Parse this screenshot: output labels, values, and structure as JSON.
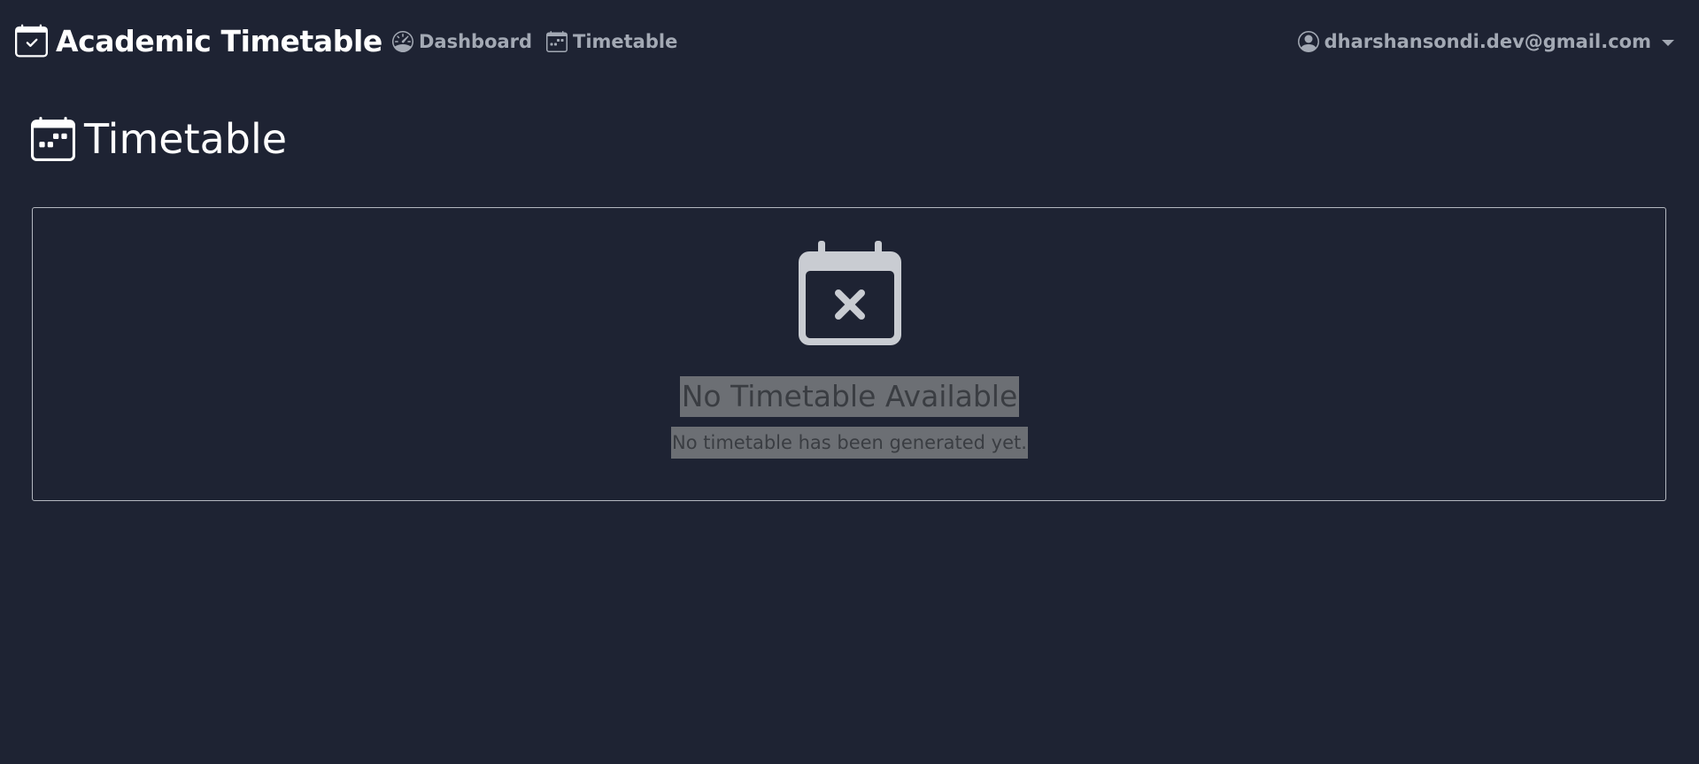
{
  "navbar": {
    "brand": "Academic Timetable",
    "links": [
      {
        "label": "Dashboard",
        "icon": "speedometer-icon"
      },
      {
        "label": "Timetable",
        "icon": "calendar-icon"
      }
    ],
    "user": {
      "email": "dharshansondi.dev@gmail.com",
      "icon": "user-circle-icon"
    }
  },
  "page": {
    "title": "Timetable",
    "title_icon": "calendar-week-icon"
  },
  "empty_state": {
    "icon": "calendar-x-icon",
    "title": "No Timetable Available",
    "message": "No timetable has been generated yet."
  },
  "colors": {
    "background": "#1e2333",
    "text": "#ffffff",
    "muted": "#a3a9b4",
    "icon": "#c9ccd2",
    "highlight": "#6c6f74"
  }
}
